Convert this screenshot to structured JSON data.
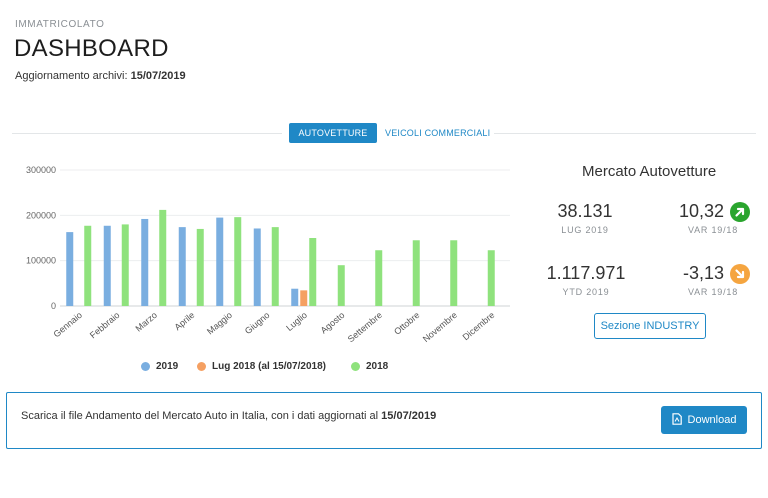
{
  "header": {
    "overline": "IMMATRICOLATO",
    "title": "DASHBOARD",
    "updated_label": "Aggiornamento archivi:",
    "updated_date": "15/07/2019"
  },
  "tabs": [
    {
      "label": "AUTOVETTURE",
      "active": true
    },
    {
      "label": "VEICOLI COMMERCIALI",
      "active": false
    }
  ],
  "colors": {
    "accent": "#1f88c6",
    "series_2019": "#7aaee0",
    "series_lug2018": "#f5a062",
    "series_2018": "#8fe27d",
    "up_arrow": "#2aa52e",
    "down_arrow": "#f5a540"
  },
  "chart_data": {
    "type": "bar",
    "categories": [
      "Gennaio",
      "Febbraio",
      "Marzo",
      "Aprile",
      "Maggio",
      "Giugno",
      "Luglio",
      "Agosto",
      "Settembre",
      "Ottobre",
      "Novembre",
      "Dicembre"
    ],
    "yticks": [
      "0",
      "100000",
      "200000",
      "300000"
    ],
    "ylim": [
      0,
      300000
    ],
    "grid": true,
    "legend_position": "bottom",
    "series": [
      {
        "name": "2019",
        "color": "#7aaee0",
        "values": [
          163000,
          177000,
          192000,
          174000,
          195000,
          171000,
          38131,
          null,
          null,
          null,
          null,
          null
        ]
      },
      {
        "name": "Lug 2018 (al 15/07/2018)",
        "color": "#f5a062",
        "values": [
          null,
          null,
          null,
          null,
          null,
          null,
          34500,
          null,
          null,
          null,
          null,
          null
        ]
      },
      {
        "name": "2018",
        "color": "#8fe27d",
        "values": [
          177000,
          180000,
          212000,
          170000,
          196000,
          174000,
          150000,
          90000,
          123000,
          145000,
          145000,
          123000
        ]
      }
    ]
  },
  "market": {
    "title": "Mercato Autovetture",
    "month_value": "38.131",
    "month_label": "LUG 2019",
    "month_var": "10,32",
    "month_var_label": "VAR 19/18",
    "ytd_value": "1.117.971",
    "ytd_label": "YTD 2019",
    "ytd_var": "-3,13",
    "ytd_var_label": "VAR 19/18",
    "industry_button": "Sezione INDUSTRY"
  },
  "banner": {
    "text": "Scarica il file Andamento del Mercato Auto in Italia, con i dati aggiornati al",
    "date": "15/07/2019",
    "download_label": "Download"
  }
}
